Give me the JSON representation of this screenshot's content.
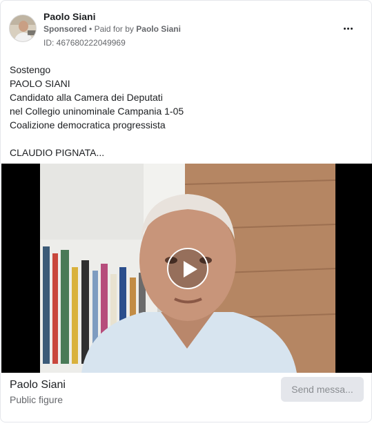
{
  "header": {
    "page_name": "Paolo Siani",
    "sponsored": "Sponsored",
    "separator": "•",
    "paid_for_prefix": "Paid for by",
    "paid_for_name": "Paolo Siani",
    "ad_id": "ID: 467680222049969",
    "more_icon": "more-horizontal-icon"
  },
  "body": {
    "lines": [
      "Sostengo",
      "PAOLO SIANI",
      "Candidato alla Camera dei Deputati",
      "nel Collegio uninominale Campania 1-05",
      "Coalizione democratica progressista",
      "",
      "CLAUDIO PIGNATA..."
    ]
  },
  "video": {
    "play_icon": "play-icon"
  },
  "footer": {
    "title": "Paolo Siani",
    "subtitle": "Public figure",
    "cta_label": "Send messa..."
  },
  "colors": {
    "primary_text": "#1c1e21",
    "secondary_text": "#65676b",
    "button_bg": "#e4e6eb",
    "button_text": "#8a8d91"
  }
}
